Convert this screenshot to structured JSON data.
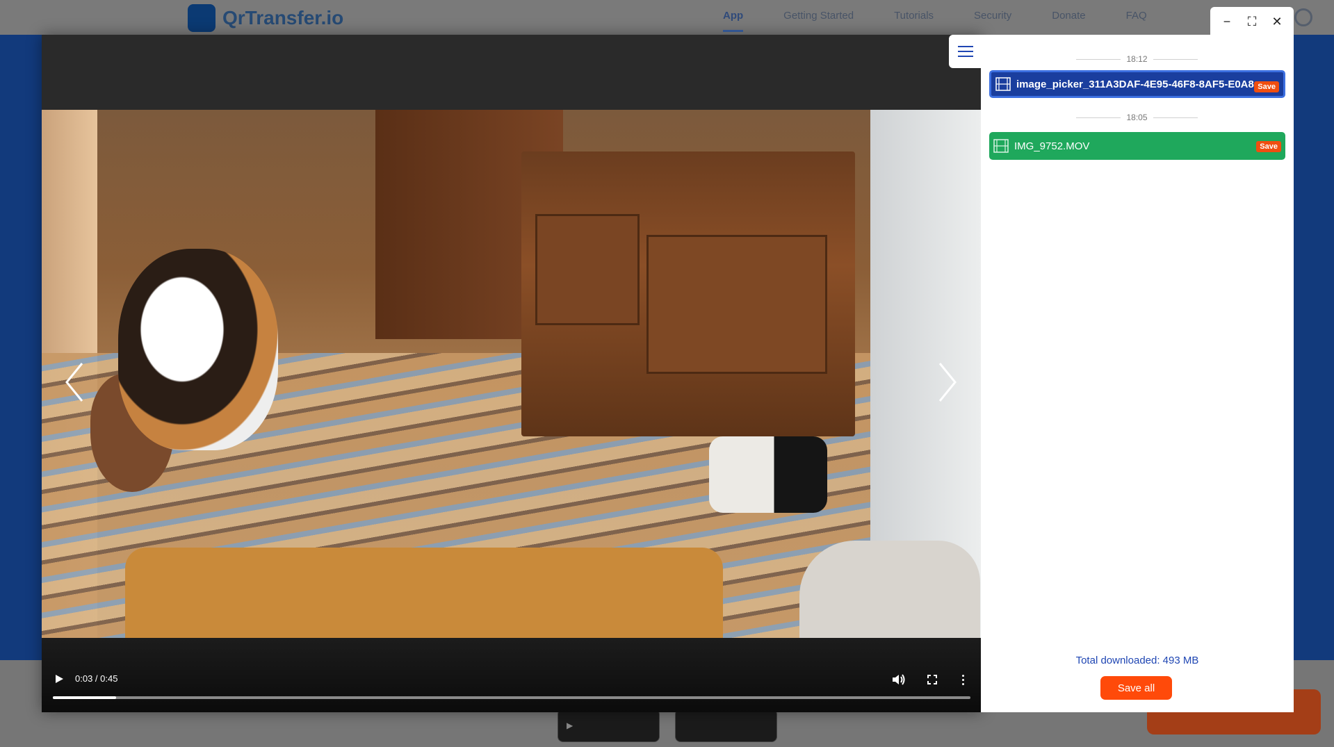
{
  "background_site": {
    "logo_text": "QrTransfer.io",
    "nav_items": [
      "App",
      "Getting Started",
      "Tutorials",
      "Security",
      "Donate",
      "FAQ"
    ]
  },
  "player": {
    "time_display": "0:03 / 0:45",
    "progress_fraction": 0.069,
    "icons": {
      "play": "play-icon",
      "volume": "volume-icon",
      "fullscreen": "fullscreen-icon",
      "more": "more-vert-icon",
      "prev": "chevron-left-icon",
      "next": "chevron-right-icon"
    }
  },
  "window_controls": {
    "minimize": "−",
    "maximize": "⛶",
    "close": "✕"
  },
  "panel": {
    "groups": [
      {
        "time": "18:12",
        "file": {
          "name": "image_picker_311A3DAF-4E95-46F8-8AF5-E0A8",
          "save_label": "Save",
          "icon": "film-icon",
          "color": "#1a3e9e"
        }
      },
      {
        "time": "18:05",
        "file": {
          "name": "IMG_9752.MOV",
          "save_label": "Save",
          "icon": "film-icon",
          "color": "#1fa85c"
        }
      }
    ],
    "total_downloaded": "Total downloaded: 493 MB",
    "save_all_label": "Save all"
  },
  "colors": {
    "accent_blue": "#1f46b3",
    "save_orange": "#ff4a0a"
  }
}
